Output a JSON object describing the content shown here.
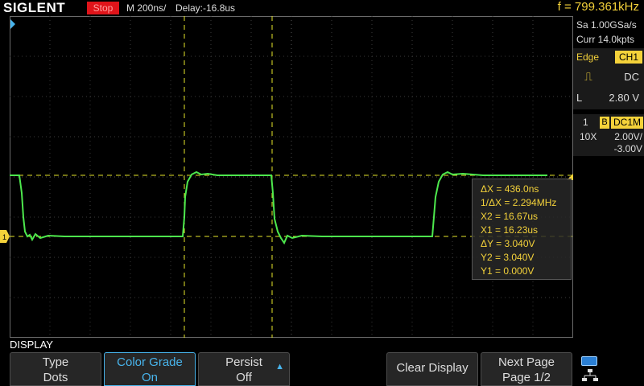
{
  "header": {
    "brand": "SIGLENT",
    "status": "Stop",
    "timebase": "M 200ns/",
    "delay": "Delay:-16.8us",
    "frequency": "f = 799.361kHz"
  },
  "acquisition": {
    "sample_rate": "Sa 1.00GSa/s",
    "memory": "Curr 14.0kpts"
  },
  "trigger": {
    "type": "Edge",
    "source": "CH1",
    "coupling": "DC",
    "level_label": "L",
    "level": "2.80 V"
  },
  "channel": {
    "number": "1",
    "bandwidth": "B",
    "coupling": "DC1M",
    "probe": "10X",
    "scale": "2.00V/",
    "offset": "-3.00V"
  },
  "cursors": {
    "dx": "ΔX = 436.0ns",
    "inv_dx": "1/ΔX = 2.294MHz",
    "x2": "X2 = 16.67us",
    "x1": "X1 = 16.23us",
    "dy": "ΔY = 3.040V",
    "y2": "Y2 = 3.040V",
    "y1": "Y1 = 0.000V"
  },
  "channel_marker": "1",
  "menu": {
    "title": "DISPLAY",
    "softkeys": [
      {
        "line1": "Type",
        "line2": "Dots"
      },
      {
        "line1": "Color Grade",
        "line2": "On"
      },
      {
        "line1": "Persist",
        "line2": "Off"
      },
      {
        "line1": "Clear Display",
        "line2": ""
      },
      {
        "line1": "Next Page",
        "line2": "Page 1/2"
      }
    ]
  },
  "colors": {
    "trace": "#4de84d",
    "cursor": "#e6e62a",
    "accent_yellow": "#f4d23a",
    "selected_blue": "#48b4ec"
  }
}
